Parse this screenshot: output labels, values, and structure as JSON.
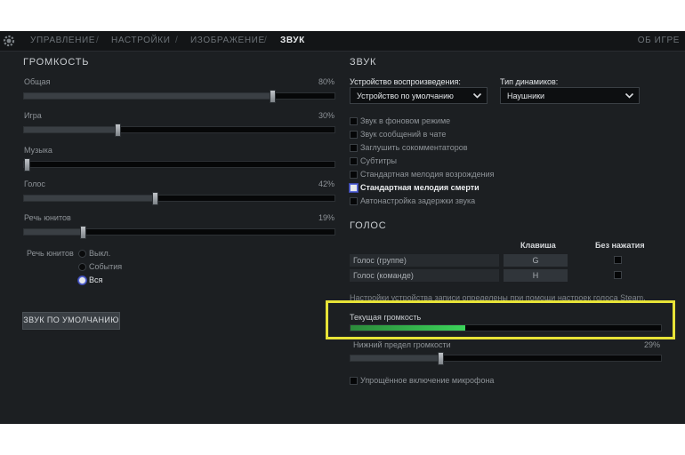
{
  "nav": {
    "tabs": [
      "УПРАВЛЕНИЕ",
      "НАСТРОЙКИ",
      "ИЗОБРАЖЕНИЕ",
      "ЗВУК"
    ],
    "separator": "/",
    "active": "ЗВУК",
    "about": "ОБ ИГРЕ"
  },
  "volume": {
    "title": "ГРОМКОСТЬ",
    "sliders": [
      {
        "label": "Общая",
        "value_text": "80%",
        "value": 0.8
      },
      {
        "label": "Игра",
        "value_text": "30%",
        "value": 0.3
      },
      {
        "label": "Музыка",
        "value_text": "",
        "value": 0.0
      },
      {
        "label": "Голос",
        "value_text": "42%",
        "value": 0.42
      },
      {
        "label": "Речь юнитов",
        "value_text": "19%",
        "value": 0.19
      }
    ],
    "unit_speech_label": "Речь юнитов",
    "unit_speech_options": [
      "Выкл.",
      "События",
      "Вся"
    ],
    "unit_speech_selected": "Вся",
    "default_button": "ЗВУК ПО УМОЛЧАНИЮ"
  },
  "sound": {
    "title": "ЗВУК",
    "playback_device_label": "Устройство воспроизведения:",
    "playback_device_value": "Устройство по умолчанию",
    "speaker_type_label": "Тип динамиков:",
    "speaker_type_value": "Наушники",
    "checkboxes": [
      {
        "label": "Звук в фоновом режиме",
        "checked": false
      },
      {
        "label": "Звук сообщений в чате",
        "checked": false
      },
      {
        "label": "Заглушить сокомментаторов",
        "checked": false
      },
      {
        "label": "Субтитры",
        "checked": false
      },
      {
        "label": "Стандартная мелодия возрождения",
        "checked": false
      },
      {
        "label": "Стандартная мелодия смерти",
        "checked": true
      },
      {
        "label": "Автонастройка задержки звука",
        "checked": false
      }
    ]
  },
  "voice": {
    "title": "ГОЛОС",
    "col_key": "Клавиша",
    "col_no_press": "Без нажатия",
    "rows": [
      {
        "label": "Голос (группе)",
        "key": "G"
      },
      {
        "label": "Голос (команде)",
        "key": "H"
      }
    ],
    "note": "Настройки устройства записи определены при помощи настроек голоса Steam.",
    "current_volume_label": "Текущая громкость",
    "current_volume_level": 0.37,
    "lower_limit_label": "Нижний предел громкости",
    "lower_limit_value_text": "29%",
    "lower_limit_value": 0.29,
    "simplified_mic_label": "Упрощённое включение микрофона"
  },
  "colors": {
    "panel_bg": "#1c1f22",
    "highlight": "#e7e337",
    "meter_green": "#3bd35a"
  }
}
